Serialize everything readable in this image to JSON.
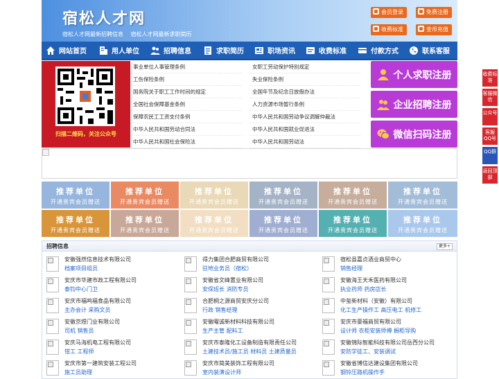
{
  "header": {
    "site_title": "宿松人才网",
    "slogan_1": "宿松人才网最新招聘信息",
    "slogan_2": "宿松人才网最新求职简历",
    "buttons": {
      "member_login": "会员登录",
      "free_register": "免费注册",
      "fee_standard": "收费标准",
      "gold_recharge": "金币充值"
    }
  },
  "nav": [
    {
      "label": "网站首页",
      "icon": "home-icon"
    },
    {
      "label": "用人单位",
      "icon": "building-icon"
    },
    {
      "label": "招聘信息",
      "icon": "people-icon"
    },
    {
      "label": "求职简历",
      "icon": "resume-icon"
    },
    {
      "label": "职场资讯",
      "icon": "news-icon"
    },
    {
      "label": "收费标准",
      "icon": "money-icon"
    },
    {
      "label": "付款方式",
      "icon": "payment-icon"
    },
    {
      "label": "联系客服",
      "icon": "phone-icon"
    }
  ],
  "qr_caption": "扫描二维码，关注公众号",
  "law_links": [
    "事业单位人事管理条例",
    "女职工劳动保护特别规定",
    "工伤保险条例",
    "失业保险条例",
    "国务院关于职工工作时间的规定",
    "全国年节及纪念日放假办法",
    "全国社会保障基金条例",
    "人力资源市场暂行条例",
    "保障农民工工资支付条例",
    "中华人民共和国劳动争议调解仲裁法",
    "中华人民共和国劳动合同法",
    "中华人民共和国就业促进法",
    "中华人民共和国社会保险法",
    "中华人民共和国劳动法"
  ],
  "register": {
    "personal": "个人求职注册",
    "company": "企业招聘注册",
    "wechat": "微信扫码注册"
  },
  "recommend": {
    "title": "推荐单位",
    "subtitle": "开通贵宾会员赠送",
    "colors": [
      "#97b6dd",
      "#e98a63",
      "#ead9b7",
      "#a5b3c7",
      "#c6ad9c",
      "#a3bdd8",
      "#d8953a",
      "#c8a898",
      "#f2dfc3",
      "#a0aed1",
      "#55b0b2",
      "#aac8ec"
    ]
  },
  "jobs": {
    "title": "招聘信息",
    "more": "更多+",
    "items": [
      {
        "company": "安徽强然信息技术有限公司",
        "positions": "档案项目组员"
      },
      {
        "company": "得力集团合肥商贸有限公司",
        "positions": "驻地业务员（宿松）"
      },
      {
        "company": "宿松县嘉贞酒业商贸中心",
        "positions": "销售经理"
      },
      {
        "company": "安庆市华建市政工程有限公司",
        "positions": "泰钧中心门卫"
      },
      {
        "company": "安徽省文峰置业有限公司",
        "positions": "安保班长 消防专员"
      },
      {
        "company": "安徽海王天禾医药有限公司",
        "positions": "执业药师 药房店长"
      },
      {
        "company": "安庆市福鸣福食品有限公司",
        "positions": "主办会计 采购文员"
      },
      {
        "company": "合肥桐之源商贸安庆分公司",
        "positions": "行政 销售经理"
      },
      {
        "company": "中玺新材料（安徽）有限公司",
        "positions": "化工生产操作工 高压电工 机修工"
      },
      {
        "company": "安徽京煜门业有限公司",
        "positions": "司机 销售员"
      },
      {
        "company": "安徽曜诚新材料科技有限公司",
        "positions": "生产主管 配料工"
      },
      {
        "company": "安庆市豪福商贸有限公司",
        "positions": "设计师 衣柜安装师傅 橱柜导购"
      },
      {
        "company": "安庆马海机电工程有限公司",
        "positions": "钳工 工程师"
      },
      {
        "company": "安庆市泰隆化工设备制造有限责任公司",
        "positions": "土建技术员/施工员 材料员 土建质量员"
      },
      {
        "company": "安徽锦际智能科技有限公司岳西分公司",
        "positions": "安防学徒工、安装调试"
      },
      {
        "company": "安庆市第一建筑安装工程公司",
        "positions": "施工员助理"
      },
      {
        "company": "安庆市简美装饰工程有限公司",
        "positions": "室内装潢设计师"
      },
      {
        "company": "安徽省博信达建设集团有限公司",
        "positions": "钢铃压路机操作手"
      }
    ]
  },
  "side_float": [
    {
      "label": "收费标准"
    },
    {
      "label": "客服微信"
    },
    {
      "label": "公众号"
    },
    {
      "label": "客服QQ号"
    },
    {
      "label": "QQ群"
    },
    {
      "label": "返回顶部"
    }
  ]
}
